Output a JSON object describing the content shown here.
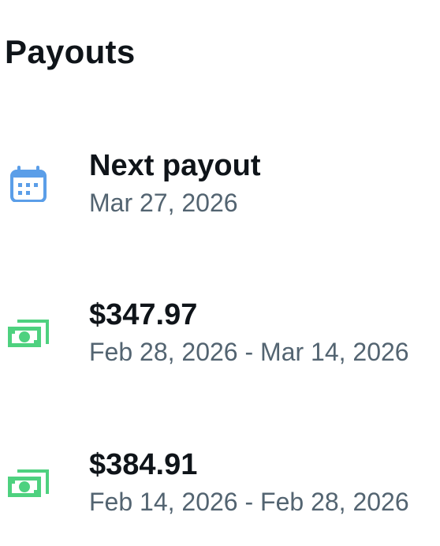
{
  "page": {
    "title": "Payouts"
  },
  "next_payout": {
    "icon": "calendar-icon",
    "title": "Next payout",
    "date": "Mar 27, 2026"
  },
  "payouts": [
    {
      "icon": "money-icon",
      "amount": "$347.97",
      "period": "Feb 28, 2026 - Mar 14, 2026"
    },
    {
      "icon": "money-icon",
      "amount": "$384.91",
      "period": "Feb 14, 2026 - Feb 28, 2026"
    }
  ],
  "colors": {
    "calendar_icon": "#5b9ee8",
    "money_icon": "#4ed17f",
    "primary_text": "#0f1419",
    "secondary_text": "#536471"
  }
}
